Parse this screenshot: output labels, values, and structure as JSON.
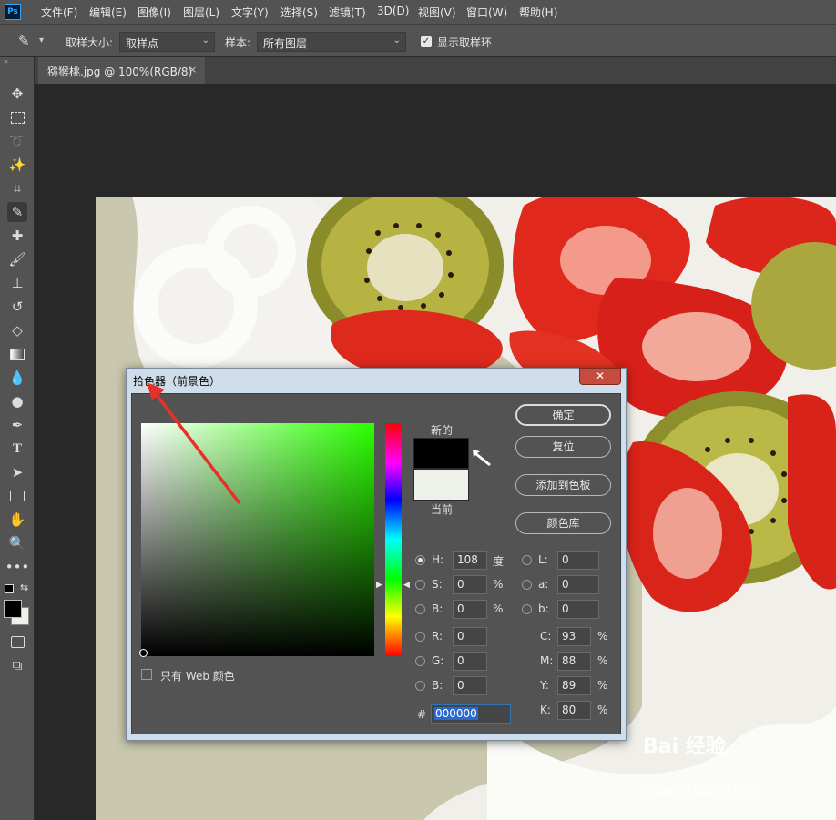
{
  "menubar": {
    "logo": "Ps",
    "items": [
      "文件(F)",
      "编辑(E)",
      "图像(I)",
      "图层(L)",
      "文字(Y)",
      "选择(S)",
      "滤镜(T)",
      "3D(D)",
      "视图(V)",
      "窗口(W)",
      "帮助(H)"
    ]
  },
  "options": {
    "sample_size_label": "取样大小:",
    "sample_size_value": "取样点",
    "sample_label": "样本:",
    "sample_value": "所有图层",
    "show_ring_label": "显示取样环",
    "show_ring_checked": true
  },
  "document": {
    "tab_title": "猕猴桃.jpg @ 100%(RGB/8)",
    "close": "×"
  },
  "watermark": {
    "logo": "Bai 经验",
    "url": "jingyan.baidu.com"
  },
  "dialog": {
    "title": "拾色器（前景色）",
    "close": "✕",
    "new_label": "新的",
    "current_label": "当前",
    "new_color": "#000000",
    "current_color": "#eef0ea",
    "buttons": {
      "ok": "确定",
      "reset": "复位",
      "add_swatch": "添加到色板",
      "color_library": "颜色库"
    },
    "hsb": {
      "h_label": "H:",
      "h_value": "108",
      "h_unit": "度",
      "s_label": "S:",
      "s_value": "0",
      "s_unit": "%",
      "b_label": "B:",
      "b_value": "0",
      "b_unit": "%"
    },
    "rgb": {
      "r_label": "R:",
      "r_value": "0",
      "g_label": "G:",
      "g_value": "0",
      "b_label": "B:",
      "b_value": "0"
    },
    "lab": {
      "l_label": "L:",
      "l_value": "0",
      "a_label": "a:",
      "a_value": "0",
      "b_label": "b:",
      "b_value": "0"
    },
    "cmyk": {
      "c_label": "C:",
      "c_value": "93",
      "m_label": "M:",
      "m_value": "88",
      "y_label": "Y:",
      "y_value": "89",
      "k_label": "K:",
      "k_value": "80",
      "unit": "%"
    },
    "hex_label": "#",
    "hex_value": "000000",
    "web_only_label": "只有 Web 颜色"
  },
  "annotation_color": "#e8302a"
}
